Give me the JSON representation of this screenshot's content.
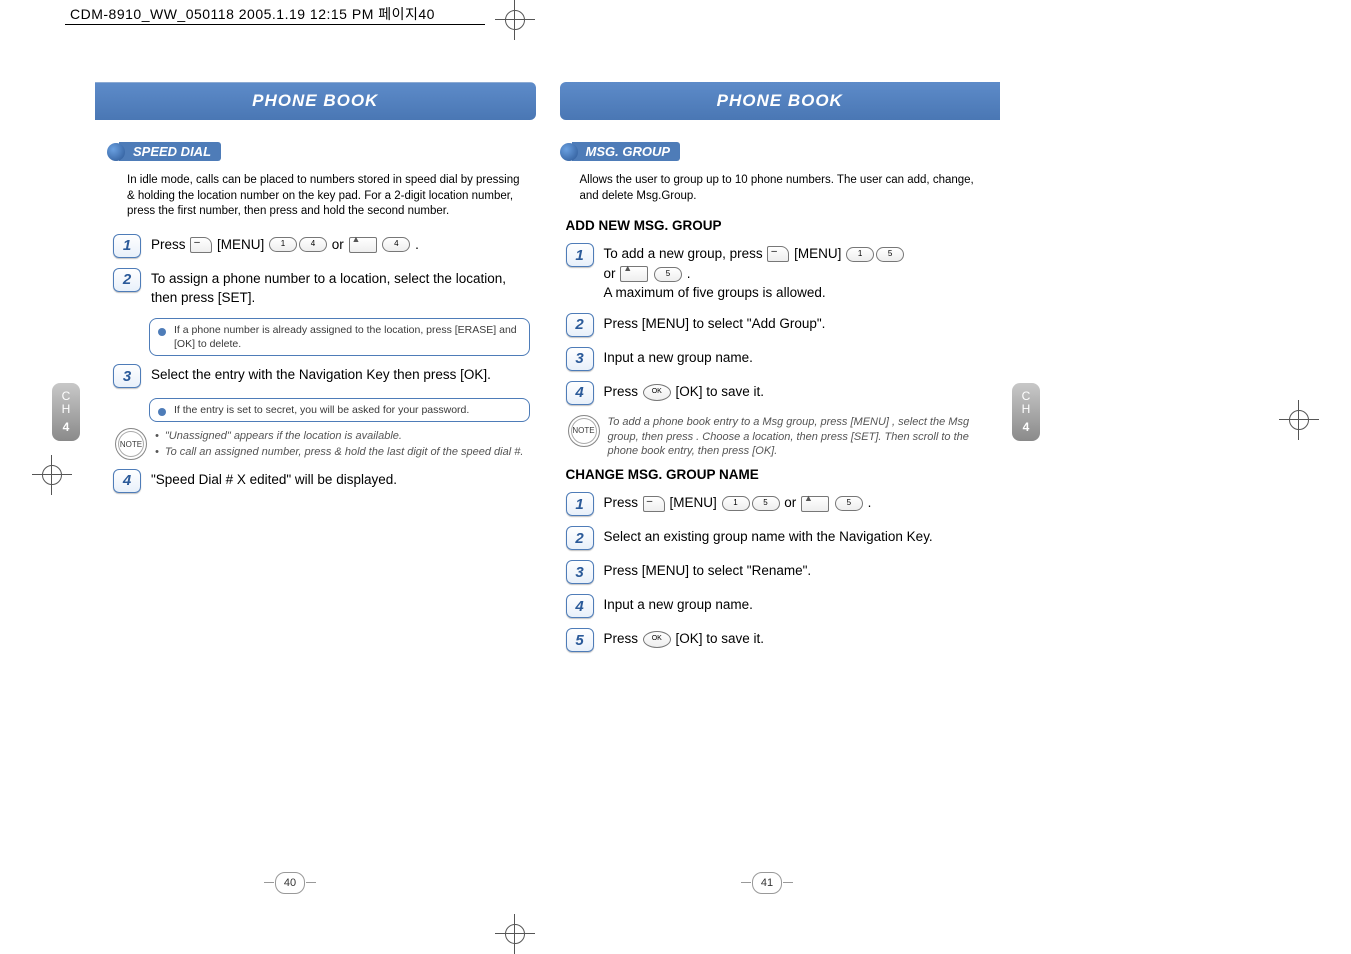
{
  "meta": {
    "filename": "CDM-8910_WW_050118  2005.1.19  12:15 PM  페이지40"
  },
  "sideTab": {
    "line1": "C",
    "line2": "H",
    "num": "4"
  },
  "pageNumbers": {
    "left": "40",
    "right": "41"
  },
  "leftPage": {
    "title": "PHONE BOOK",
    "sectionLabel": "SPEED DIAL",
    "intro": "In idle mode, calls can be placed to numbers stored in speed dial by pressing & holding the location number on the key pad. For a 2-digit location number, press the first number, then press and hold the second number.",
    "steps": {
      "s1": "Press      [MENU]            or        .",
      "s2": "To assign a phone number to a location, select the location, then press     [SET].",
      "s2tip": "If a phone number is already assigned to the location, press     [ERASE] and     [OK] to delete.",
      "s3": "Select the entry with the Navigation Key then press     [OK].",
      "s3tip": "If the entry is set to secret, you will be asked for your password.",
      "s4": "\"Speed Dial # X edited\" will be displayed."
    },
    "note": {
      "label": "NOTE",
      "b1": "\"Unassigned\" appears if the location is available.",
      "b2": "To call an assigned number, press & hold the last digit of the speed dial #."
    }
  },
  "rightPage": {
    "title": "PHONE BOOK",
    "sectionLabel": "MSG. GROUP",
    "intro": "Allows the user to group up to 10 phone numbers. The user can add, change, and delete Msg.Group.",
    "sub1": "ADD NEW MSG. GROUP",
    "add": {
      "s1a": "To add a new group, press      [MENU]          ",
      "s1b": "or        .",
      "s1c": "A maximum of five groups is allowed.",
      "s2": "Press      [MENU] to select \"Add Group\".",
      "s3": "Input a new group name.",
      "s4": "Press     [OK] to save it."
    },
    "note": {
      "label": "NOTE",
      "text": "To add a phone book entry to a Msg group, press      [MENU]           , select the Msg group, then press     . Choose a location, then press      [SET].  Then scroll to the phone book entry, then press      [OK]."
    },
    "sub2": "CHANGE MSG. GROUP NAME",
    "chg": {
      "s1": "Press      [MENU]            or        .",
      "s2": "Select an existing group name with the Navigation Key.",
      "s3": "Press      [MENU] to select \"Rename\".",
      "s4": "Input a new group name.",
      "s5": "Press     [OK] to save it."
    }
  }
}
